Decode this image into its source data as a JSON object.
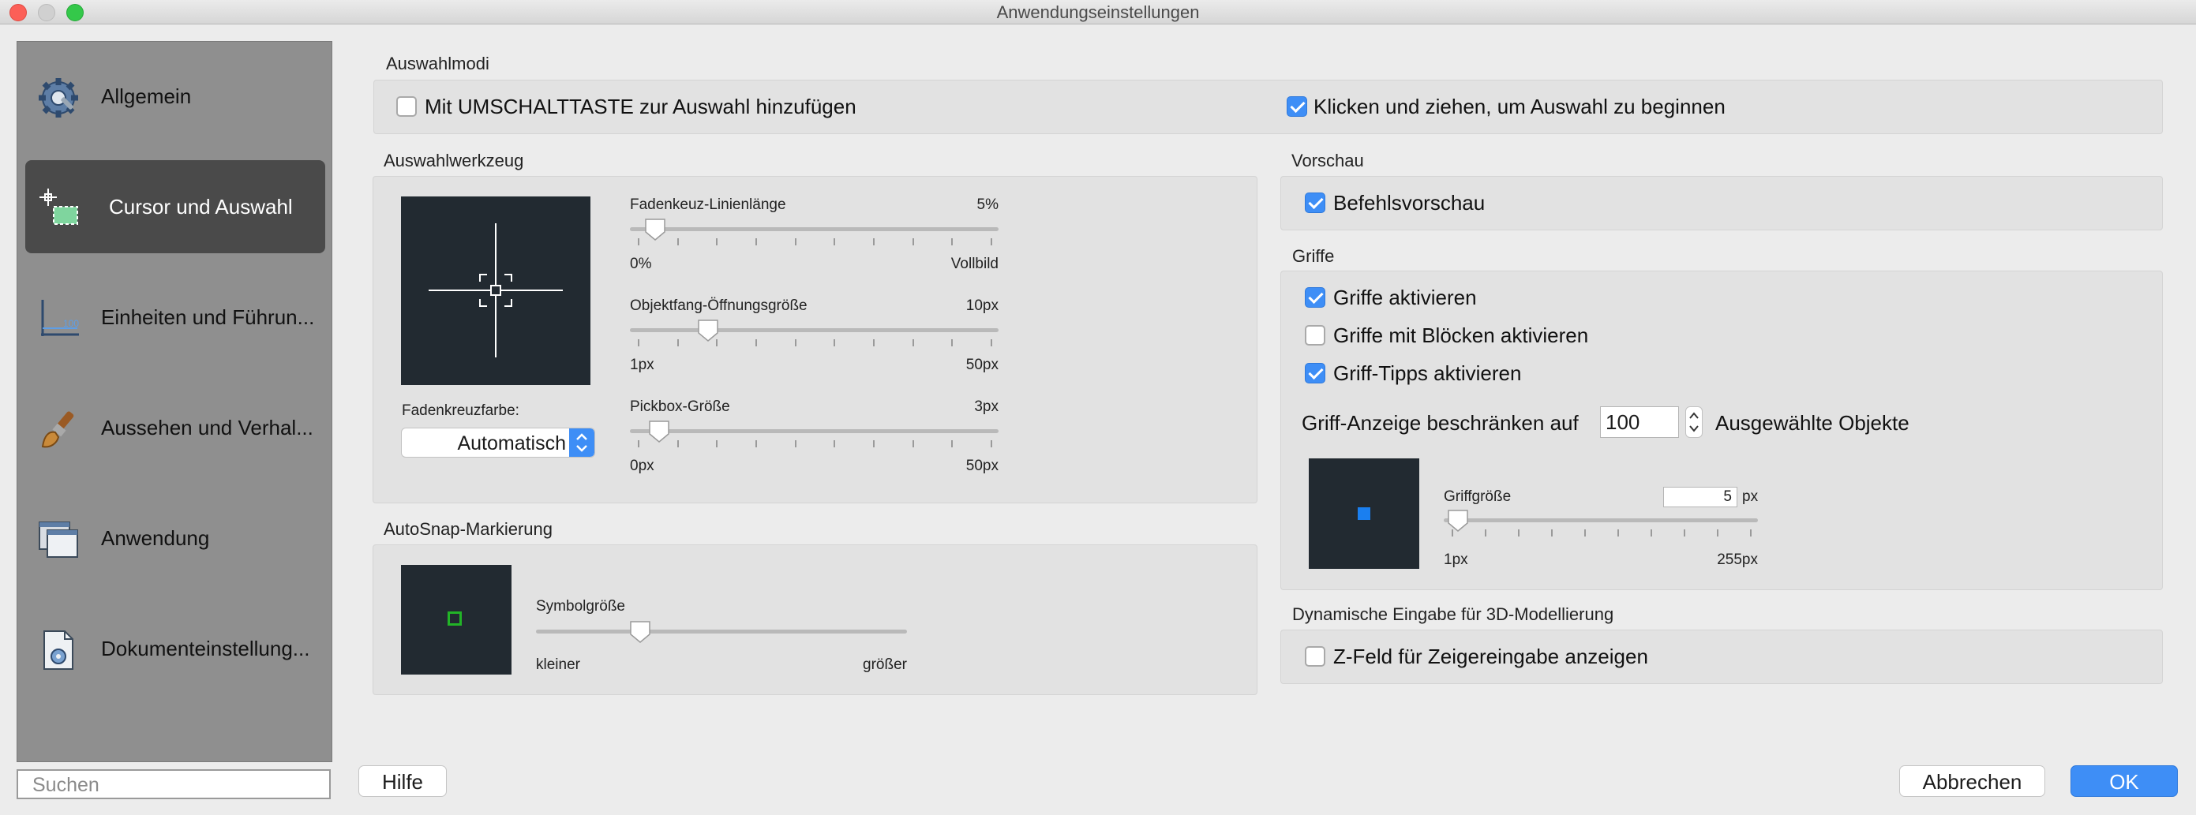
{
  "window": {
    "title": "Anwendungseinstellungen"
  },
  "sidebar": {
    "items": [
      {
        "label": "Allgemein",
        "icon": "gear-icon"
      },
      {
        "label": "Cursor und Auswahl",
        "icon": "cursor-selection-icon",
        "active": true
      },
      {
        "label": "Einheiten und Führun...",
        "icon": "units-icon"
      },
      {
        "label": "Aussehen und Verhal...",
        "icon": "brush-icon"
      },
      {
        "label": "Anwendung",
        "icon": "windows-icon"
      },
      {
        "label": "Dokumenteinstellung...",
        "icon": "document-icon"
      }
    ],
    "search_placeholder": "Suchen"
  },
  "auswahlmodi": {
    "title": "Auswahlmodi",
    "shift_label": "Mit UMSCHALTTASTE zur Auswahl hinzufügen",
    "shift_checked": false,
    "drag_label": "Klicken und ziehen, um Auswahl zu beginnen",
    "drag_checked": true
  },
  "auswahlwerkzeug": {
    "title": "Auswahlwerkzeug",
    "color_label": "Fadenkreuzfarbe:",
    "color_value": "Automatisch",
    "sliders": [
      {
        "label": "Fadenkeuz-Linienlänge",
        "value": "5%",
        "min": "0%",
        "max": "Vollbild",
        "fraction": 0.05
      },
      {
        "label": "Objektfang-Öffnungsgröße",
        "value": "10px",
        "min": "1px",
        "max": "50px",
        "fraction": 0.2
      },
      {
        "label": "Pickbox-Größe",
        "value": "3px",
        "min": "0px",
        "max": "50px",
        "fraction": 0.06
      }
    ]
  },
  "autosnap": {
    "title": "AutoSnap-Markierung",
    "slider_label": "Symbolgröße",
    "min": "kleiner",
    "max": "größer",
    "fraction": 0.27,
    "marker_color": "#22b427"
  },
  "vorschau": {
    "title": "Vorschau",
    "label": "Befehlsvorschau",
    "checked": true
  },
  "griffe": {
    "title": "Griffe",
    "options": [
      {
        "label": "Griffe aktivieren",
        "checked": true
      },
      {
        "label": "Griffe mit Blöcken aktivieren",
        "checked": false
      },
      {
        "label": "Griff-Tipps aktivieren",
        "checked": true
      }
    ],
    "limit_label": "Griff-Anzeige beschränken auf",
    "limit_value": "100",
    "limit_suffix": "Ausgewählte Objekte",
    "size_label": "Griffgröße",
    "size_value": "5",
    "size_unit": "px",
    "min": "1px",
    "max": "255px",
    "fraction": 0.02,
    "grip_color": "#1a7ff0"
  },
  "dynamic": {
    "title": "Dynamische Eingabe für 3D-Modellierung",
    "label": "Z-Feld für Zeigereingabe anzeigen",
    "checked": false
  },
  "buttons": {
    "help": "Hilfe",
    "cancel": "Abbrechen",
    "ok": "OK"
  },
  "colors": {
    "accent": "#3e8ef6",
    "sidebar_active": "#4a4a4a",
    "preview_bg": "#222a31"
  }
}
